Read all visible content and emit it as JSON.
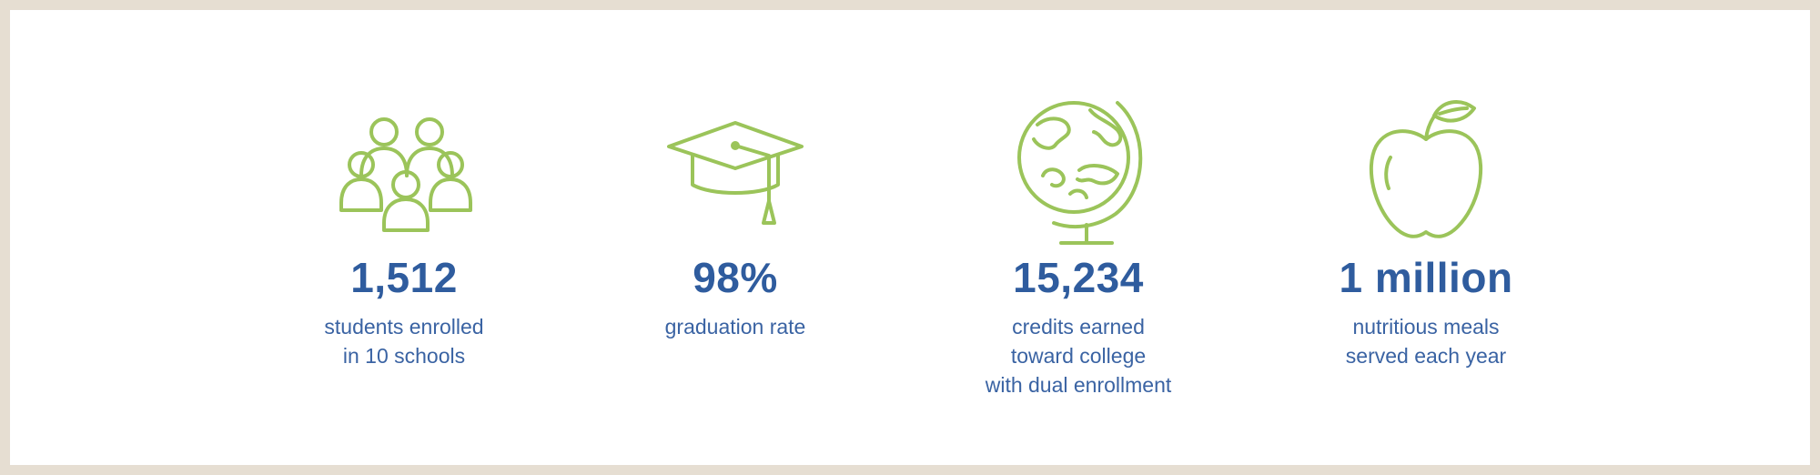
{
  "colors": {
    "frame": "#e6ded2",
    "card": "#ffffff",
    "value_text": "#2f5c9e",
    "caption_text": "#3a63a3",
    "icon": "#9bc45a"
  },
  "stats": [
    {
      "icon": "people-group-icon",
      "value": "1,512",
      "caption_lines": [
        "students enrolled",
        "in 10 schools"
      ]
    },
    {
      "icon": "graduation-cap-icon",
      "value": "98%",
      "caption_lines": [
        "graduation rate"
      ]
    },
    {
      "icon": "globe-icon",
      "value": "15,234",
      "caption_lines": [
        "credits earned",
        "toward college",
        "with dual enrollment"
      ]
    },
    {
      "icon": "apple-icon",
      "value": "1 million",
      "caption_lines": [
        "nutritious meals",
        "served each year"
      ]
    }
  ]
}
